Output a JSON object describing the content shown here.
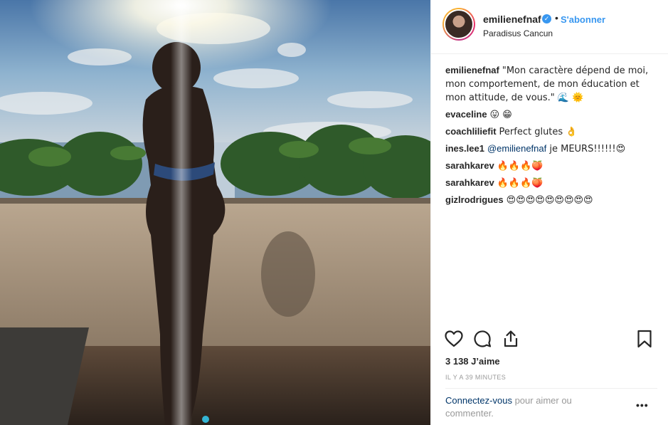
{
  "post": {
    "username": "emilienefnaf",
    "verified_icon": "verified-badge-icon",
    "separator": "•",
    "follow_label": "S'abonner",
    "location": "Paradisus Cancun"
  },
  "caption": {
    "author": "emilienefnaf",
    "text": "\"Mon caractère dépend de moi, mon comportement, de mon éducation et mon attitude, de vous.\" 🌊 🌞"
  },
  "comments": [
    {
      "author": "evaceline",
      "text": "😛 😁"
    },
    {
      "author": "coachliliefit",
      "text": "Perfect glutes 👌"
    },
    {
      "author": "ines.lee1",
      "mention": "@emilienefnaf",
      "text": " je MEURS!!!!!!😍"
    },
    {
      "author": "sarahkarev",
      "text": "🔥🔥🔥🍑"
    },
    {
      "author": "sarahkarev",
      "text": "🔥🔥🔥🍑"
    },
    {
      "author": "gizlrodrigues",
      "text": "😍😍😍😍😍😍😍😍😍"
    }
  ],
  "actions": {
    "icons": [
      "heart-icon",
      "comment-icon",
      "share-icon",
      "bookmark-icon"
    ],
    "likes": "3 138 J’aime",
    "time": "IL Y A 39 MINUTES"
  },
  "login": {
    "link": "Connectez-vous",
    "text": " pour aimer ou commenter.",
    "more": "•••"
  },
  "colors": {
    "accent": "#3897f0",
    "text": "#262626",
    "muted": "#999999",
    "link": "#003569",
    "carousel_dot": "#34b5d4"
  }
}
